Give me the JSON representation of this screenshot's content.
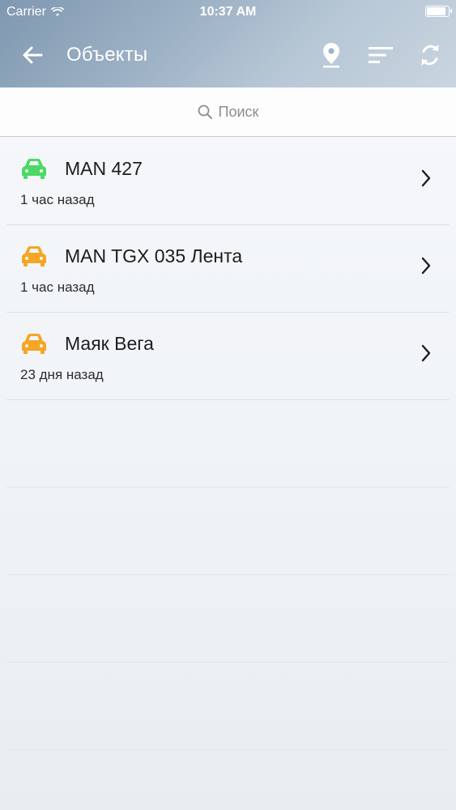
{
  "status_bar": {
    "carrier": "Carrier",
    "time": "10:37 AM",
    "battery_level": 0.9
  },
  "nav": {
    "title": "Объекты",
    "icons": [
      "arrow-left-icon",
      "map-pin-icon",
      "sort-icon",
      "refresh-icon"
    ]
  },
  "search": {
    "placeholder": "Поиск"
  },
  "objects": [
    {
      "name": "MAN 427",
      "last_seen": "1 час назад",
      "status_color": "#4cd964"
    },
    {
      "name": "MAN TGX 035 Лента",
      "last_seen": "1 час назад",
      "status_color": "#f5a623"
    },
    {
      "name": "Маяк Вега",
      "last_seen": "23 дня назад",
      "status_color": "#f5a623"
    }
  ]
}
